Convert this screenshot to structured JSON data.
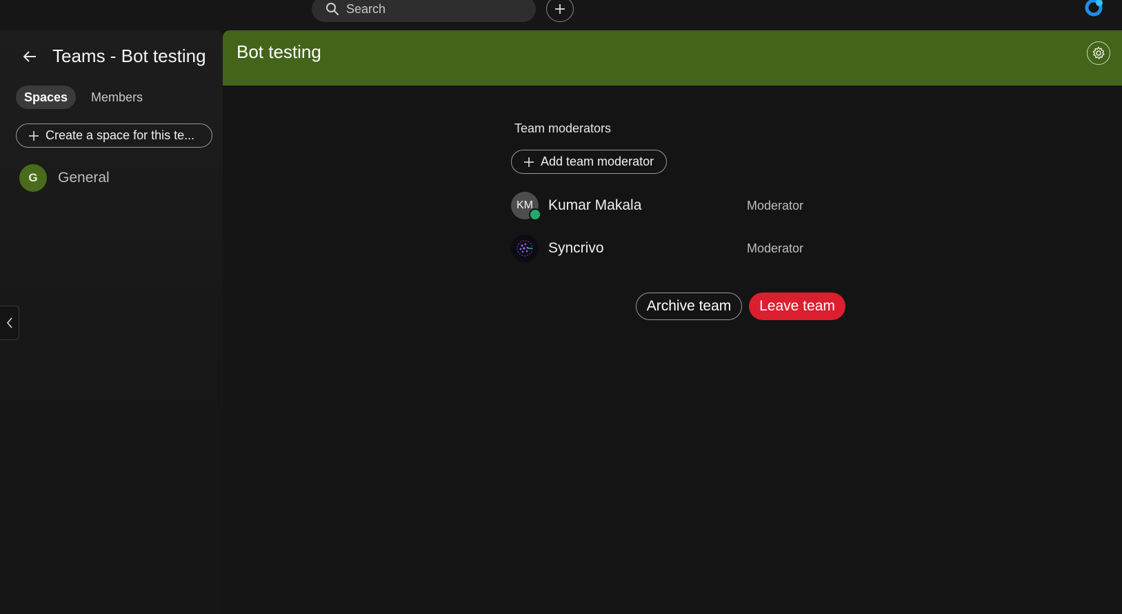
{
  "topbar": {
    "search_placeholder": "Search",
    "search_icon": "search-icon",
    "add_icon": "plus-icon",
    "logo_icon": "webex-logo"
  },
  "sidebar": {
    "title": "Teams - Bot testing",
    "tabs": [
      {
        "label": "Spaces",
        "active": true
      },
      {
        "label": "Members",
        "active": false
      }
    ],
    "create_space_label": "Create a space for this te...",
    "spaces": [
      {
        "initial": "G",
        "name": "General",
        "color": "#4a6b1b"
      }
    ]
  },
  "header": {
    "title": "Bot testing",
    "color": "#436419",
    "settings_icon": "gear-icon"
  },
  "moderators": {
    "section_title": "Team moderators",
    "add_label": "Add team moderator",
    "members": [
      {
        "initials": "KM",
        "name": "Kumar Makala",
        "role": "Moderator",
        "online": true
      },
      {
        "initials": "",
        "name": "Syncrivo",
        "role": "Moderator",
        "online": false
      }
    ]
  },
  "actions": {
    "archive_label": "Archive team",
    "leave_label": "Leave team",
    "leave_color": "#db1f2e"
  }
}
